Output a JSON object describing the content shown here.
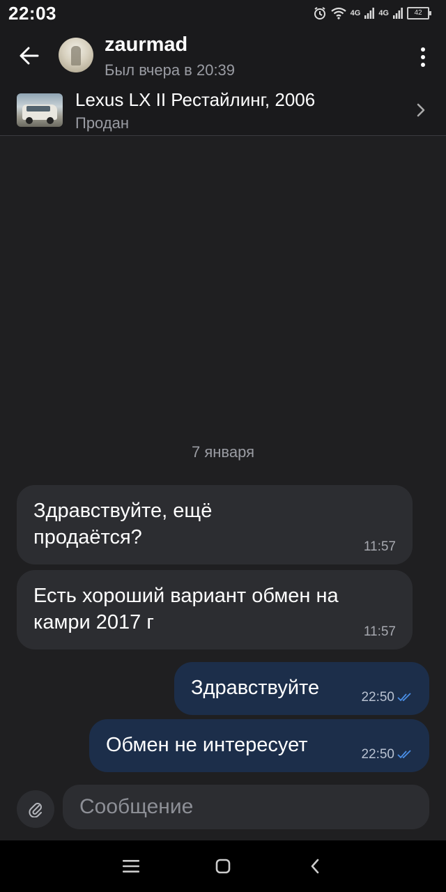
{
  "status_bar": {
    "time": "22:03",
    "network_1": "4G",
    "network_2": "4G",
    "battery": "42"
  },
  "header": {
    "back_icon": "arrow-left-icon",
    "user_name": "zaurmad",
    "user_status": "Был вчера в 20:39",
    "menu_icon": "more-vertical-icon"
  },
  "listing": {
    "title": "Lexus LX II Рестайлинг, 2006",
    "status": "Продан",
    "chevron_icon": "chevron-right-icon"
  },
  "chat": {
    "date_separator": "7 января",
    "messages": [
      {
        "direction": "incoming",
        "text": "Здравствуйте, ещё\nпродаётся?",
        "time": "11:57"
      },
      {
        "direction": "incoming",
        "text": "Есть хороший вариант обмен на\nкамри 2017 г",
        "time": "11:57"
      },
      {
        "direction": "outgoing",
        "text": "Здравствуйте",
        "time": "22:50",
        "read": true
      },
      {
        "direction": "outgoing",
        "text": "Обмен не интересует",
        "time": "22:50",
        "read": true
      }
    ]
  },
  "composer": {
    "attach_icon": "paperclip-icon",
    "placeholder": "Сообщение"
  },
  "nav_bar": {
    "icons": [
      "menu-icon",
      "home-icon",
      "back-icon"
    ]
  },
  "colors": {
    "background": "#1f1f21",
    "incoming_bubble": "#2c2d31",
    "outgoing_bubble": "#1c2e4a",
    "read_check": "#4a8fe7"
  }
}
